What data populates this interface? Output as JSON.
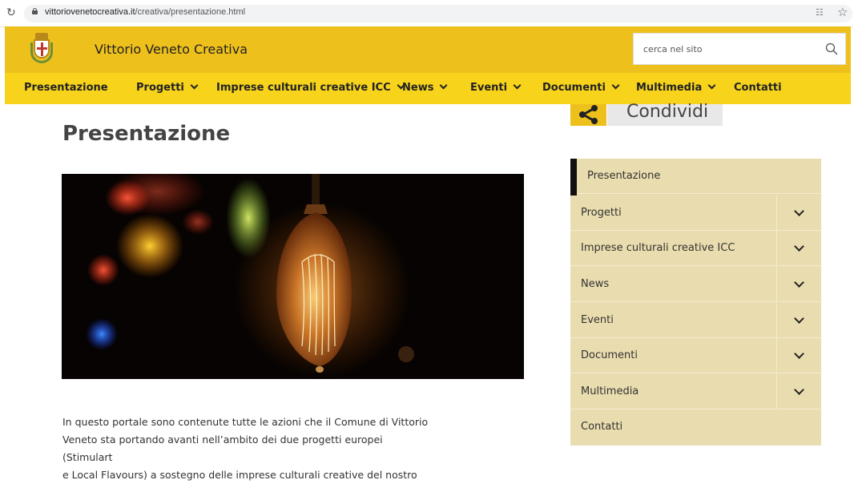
{
  "browser": {
    "reload_icon": "reload-icon",
    "url_host": "vittoriovenetocreativa.it",
    "url_path": "/creativa/presentazione.html"
  },
  "header": {
    "site_title": "Vittorio Veneto Creativa",
    "search_placeholder": "cerca nel sito",
    "colors": {
      "header_bg": "#eec01c",
      "nav_bg": "#f7d31c"
    }
  },
  "nav": {
    "items": [
      {
        "label": "Presentazione"
      },
      {
        "label": "Progetti"
      },
      {
        "label": "Imprese culturali creative ICC"
      },
      {
        "label": "News"
      },
      {
        "label": "Eventi"
      },
      {
        "label": "Documenti"
      },
      {
        "label": "Multimedia"
      },
      {
        "label": "Contatti"
      }
    ]
  },
  "share": {
    "label": "Condividi"
  },
  "main": {
    "title": "Presentazione",
    "intro_lines": [
      "In questo portale sono contenute tutte le azioni che il Comune di Vittorio",
      "Veneto sta portando avanti nell’ambito dei due progetti europei (Stimulart",
      "e Local Flavours) a sostegno delle imprese culturali creative del nostro"
    ]
  },
  "side_menu": {
    "items": [
      {
        "label": "Presentazione"
      },
      {
        "label": "Progetti"
      },
      {
        "label": "Imprese culturali creative ICC"
      },
      {
        "label": "News"
      },
      {
        "label": "Eventi"
      },
      {
        "label": "Documenti"
      },
      {
        "label": "Multimedia"
      },
      {
        "label": "Contatti"
      }
    ]
  }
}
